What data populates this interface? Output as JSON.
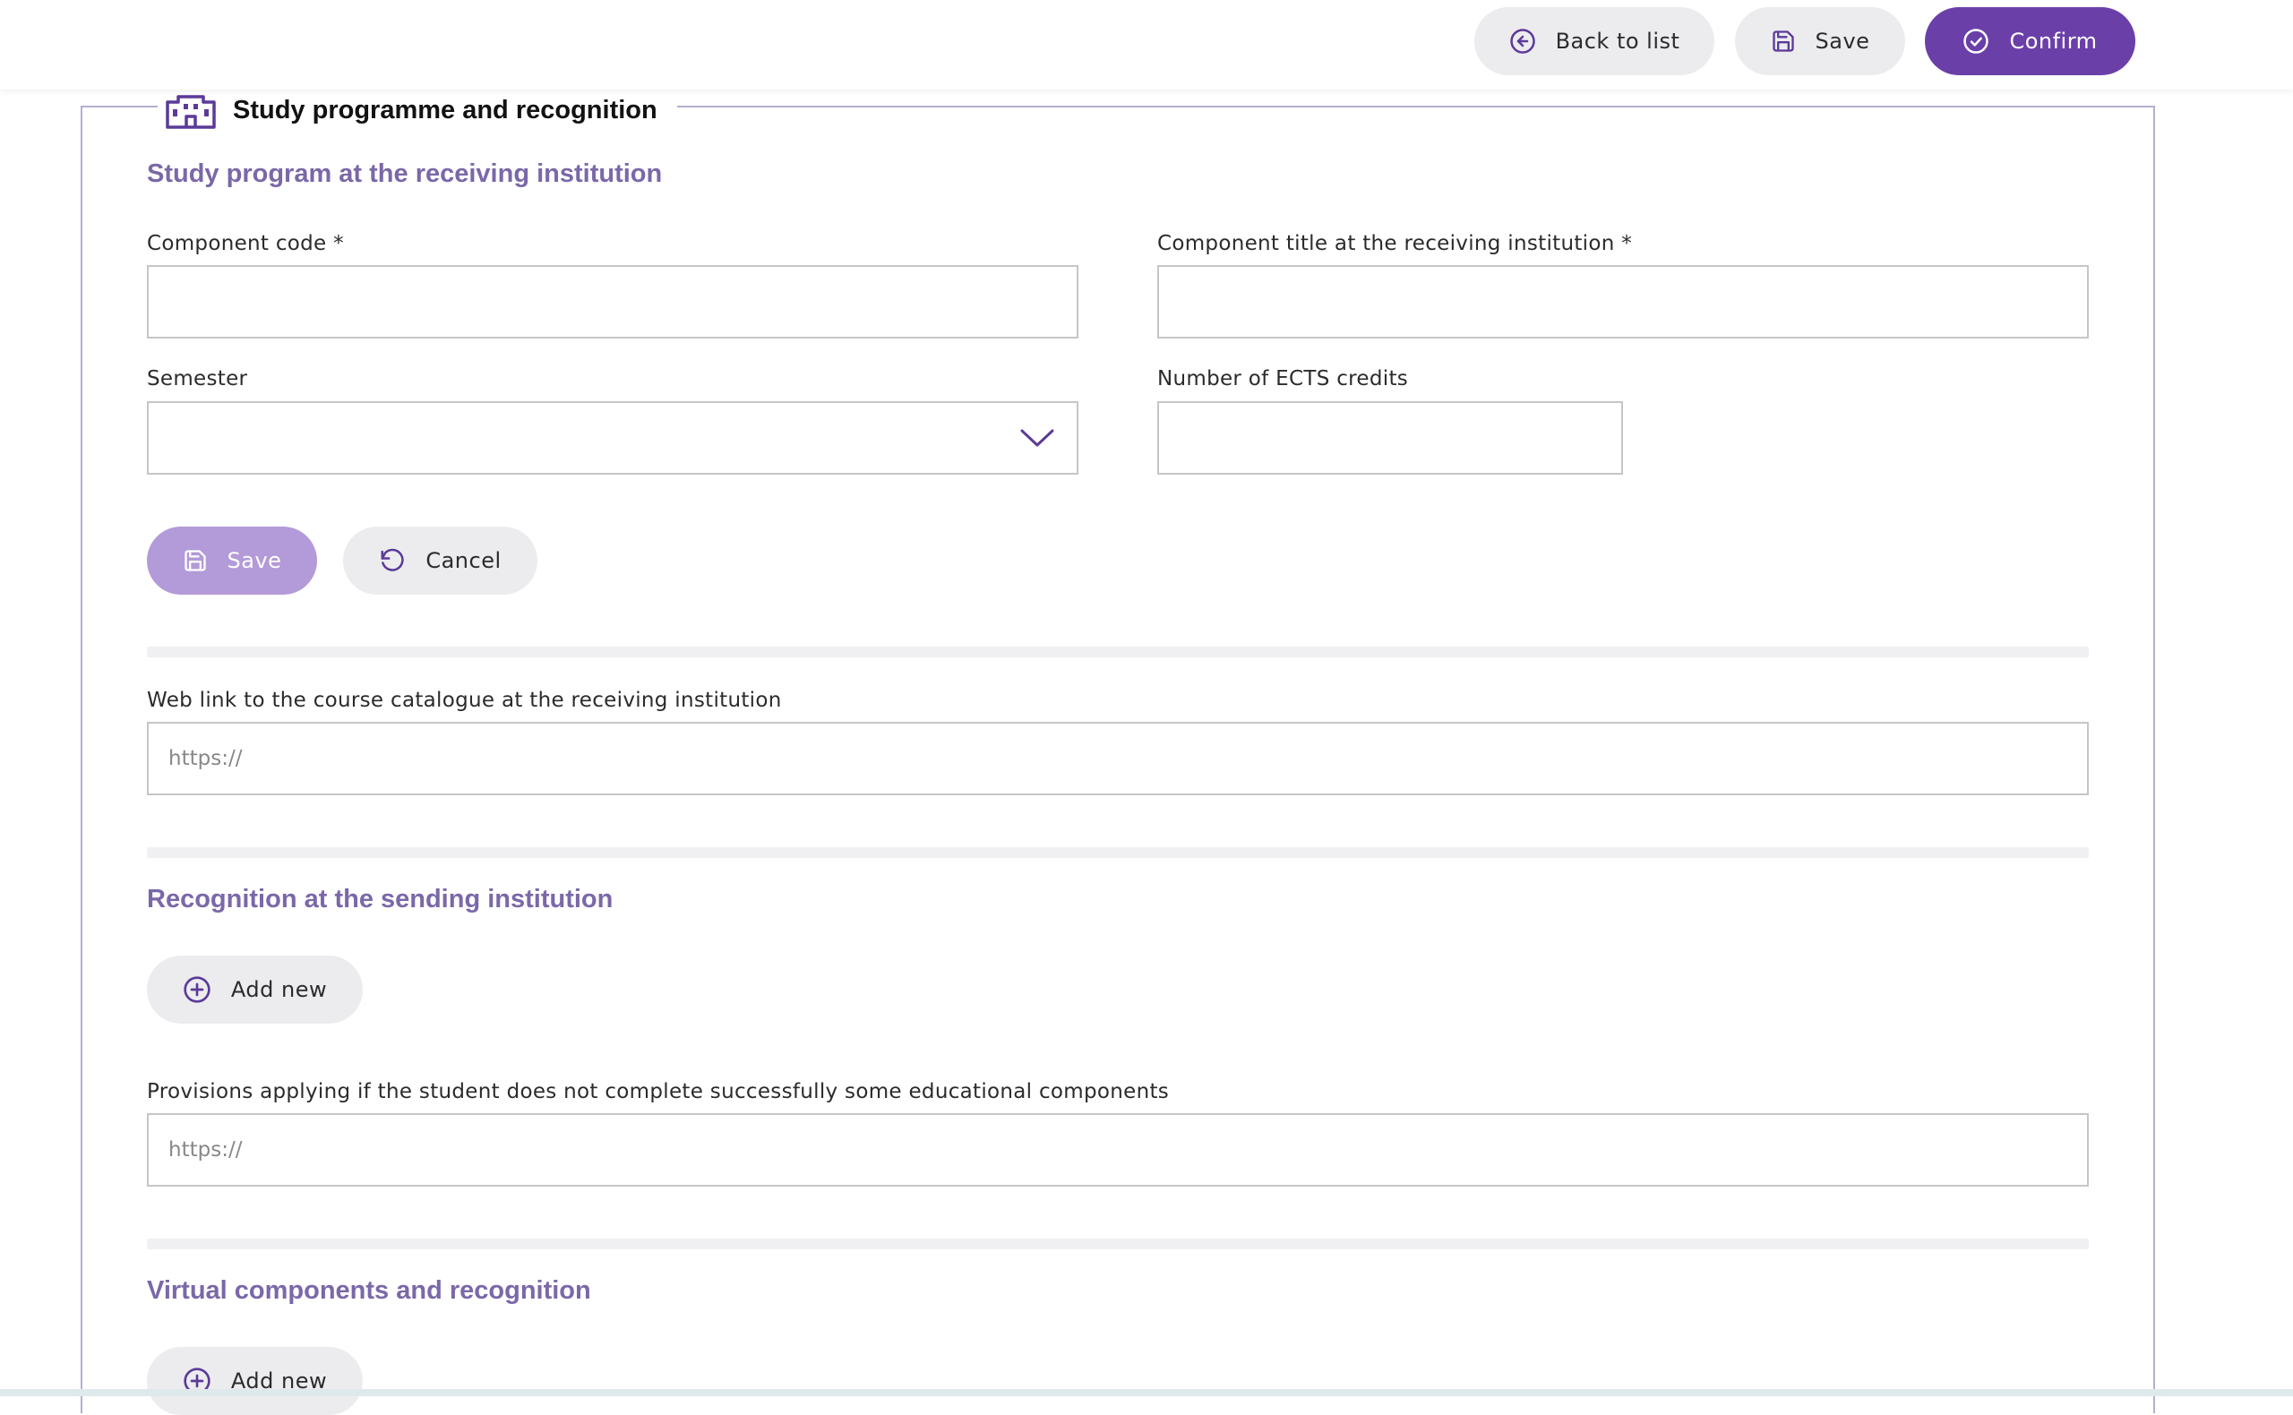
{
  "toolbar": {
    "back_label": "Back to list",
    "save_label": "Save",
    "confirm_label": "Confirm"
  },
  "fieldset": {
    "legend": "Study programme and recognition"
  },
  "study_program": {
    "title": "Study program at the receiving institution",
    "component_code": {
      "label": "Component code *",
      "value": ""
    },
    "component_title": {
      "label": "Component title at the receiving institution *",
      "value": ""
    },
    "semester": {
      "label": "Semester",
      "value": ""
    },
    "ects": {
      "label": "Number of ECTS credits",
      "value": ""
    },
    "save_label": "Save",
    "cancel_label": "Cancel"
  },
  "web_link": {
    "label": "Web link to the course catalogue at the receiving institution",
    "placeholder": "https://"
  },
  "recognition": {
    "title": "Recognition at the sending institution",
    "add_label": "Add new",
    "provisions_label": "Provisions applying if the student does not complete successfully some educational components",
    "provisions_placeholder": "https://"
  },
  "virtual": {
    "title": "Virtual components and recognition",
    "add_label": "Add new"
  },
  "colors": {
    "accent": "#6b3fa8",
    "accent_light": "#b39ad8",
    "section_title": "#7a68a8",
    "icon": "#5b3a98"
  }
}
